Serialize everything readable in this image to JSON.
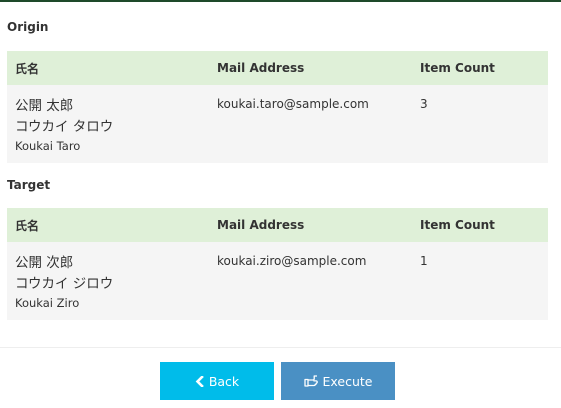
{
  "origin": {
    "title": "Origin",
    "headers": {
      "name": "氏名",
      "mail": "Mail Address",
      "count": "Item Count"
    },
    "row": {
      "name_kanji": "公開 太郎",
      "name_kana": "コウカイ タロウ",
      "name_roman": "Koukai Taro",
      "mail": "koukai.taro@sample.com",
      "count": "3"
    }
  },
  "target": {
    "title": "Target",
    "headers": {
      "name": "氏名",
      "mail": "Mail Address",
      "count": "Item Count"
    },
    "row": {
      "name_kanji": "公開 次郎",
      "name_kana": "コウカイ ジロウ",
      "name_roman": "Koukai Ziro",
      "mail": "koukai.ziro@sample.com",
      "count": "1"
    }
  },
  "actions": {
    "back_label": "Back",
    "execute_label": "Execute",
    "back_icon": "chevron-left-icon",
    "execute_icon": "hand-pointer-icon"
  },
  "colors": {
    "header_bg": "#dff0d8",
    "row_bg": "#f5f5f5",
    "back_button": "#00bcea",
    "execute_button": "#4a90c4",
    "top_bar": "#1e4a2a"
  }
}
